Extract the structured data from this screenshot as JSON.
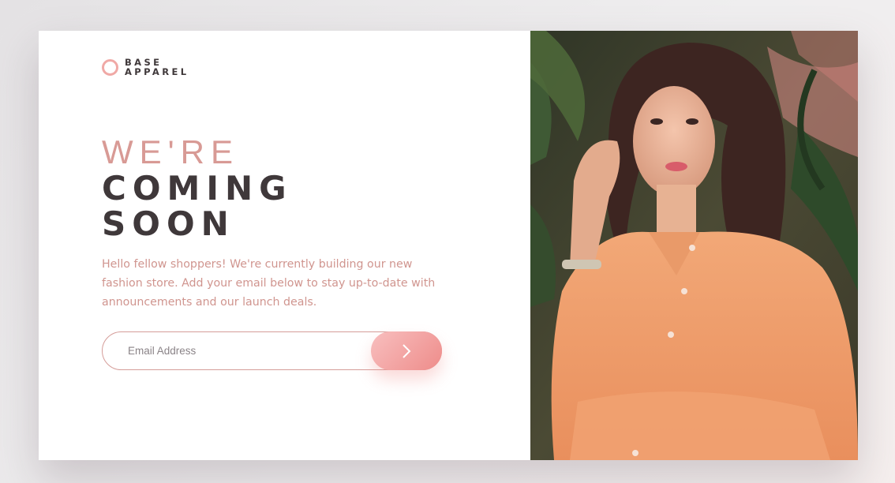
{
  "brand": {
    "line1": "BASE",
    "line2": "APPAREL",
    "ring_color": "#f0a9a6"
  },
  "hero": {
    "light_line": "WE'RE",
    "bold_line1": "COMING",
    "bold_line2": "SOON",
    "description": "Hello fellow shoppers! We're currently building our new fashion store. Add your email below to stay up-to-date with announcements and our launch deals."
  },
  "form": {
    "email_placeholder": "Email Address",
    "email_value": "",
    "submit_icon": "chevron-right-icon"
  },
  "colors": {
    "accent": "#ee8c8a",
    "accent_light": "#f8bfbf",
    "text_dark": "#3f383a",
    "text_pink": "#d0958f"
  },
  "image": {
    "subject": "hero-model-photo"
  }
}
